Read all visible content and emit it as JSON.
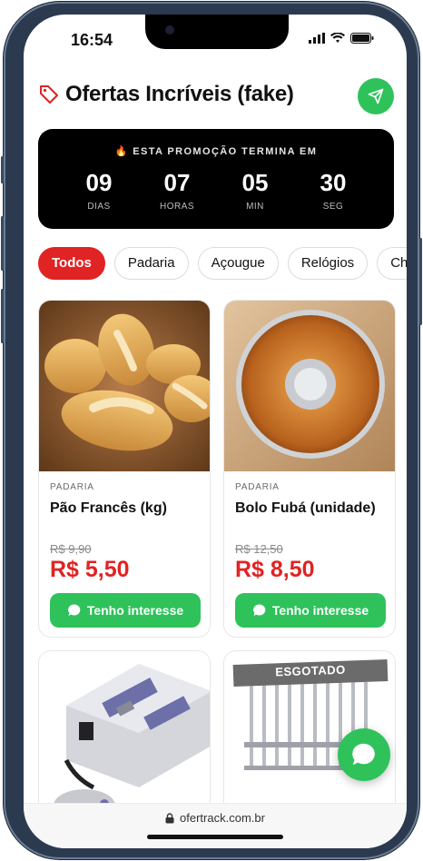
{
  "status": {
    "time": "16:54"
  },
  "header": {
    "title": "Ofertas Incríveis (fake)"
  },
  "countdown": {
    "label": "🔥 ESTA PROMOÇÃO TERMINA EM",
    "units": [
      {
        "value": "09",
        "caption": "DIAS"
      },
      {
        "value": "07",
        "caption": "HORAS"
      },
      {
        "value": "05",
        "caption": "MIN"
      },
      {
        "value": "30",
        "caption": "SEG"
      }
    ]
  },
  "categories": [
    "Todos",
    "Padaria",
    "Açougue",
    "Relógios",
    "Chu"
  ],
  "products": [
    {
      "category": "PADARIA",
      "name": "Pão Francês (kg)",
      "old_price": "R$ 9,90",
      "price": "R$ 5,50",
      "cta": "Tenho interesse"
    },
    {
      "category": "PADARIA",
      "name": "Bolo Fubá (unidade)",
      "old_price": "R$ 12,50",
      "price": "R$ 8,50",
      "cta": "Tenho interesse"
    },
    {
      "badge": "ESGOTADO"
    }
  ],
  "footer": {
    "url": "ofertrack.com.br"
  },
  "colors": {
    "accent_green": "#2fc25b",
    "price_red": "#e02323",
    "countdown_bg": "#000000"
  }
}
